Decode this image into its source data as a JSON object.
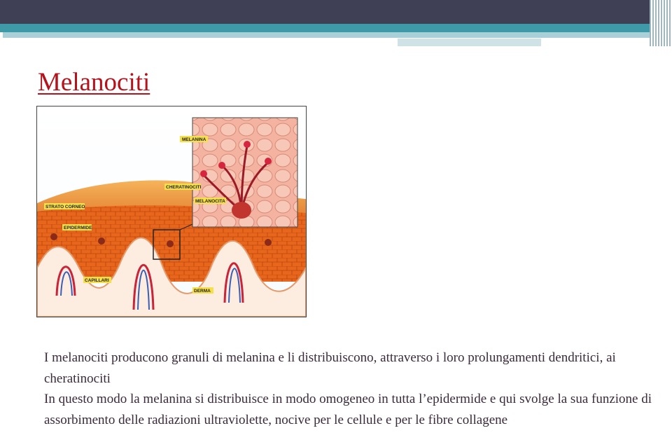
{
  "slide": {
    "title": "Melanociti",
    "figure": {
      "labels": {
        "melanina": "MELANINA",
        "cheratinociti": "CHERATINOCITI",
        "melanocita": "MELANOCITA",
        "strato_corneo": "STRATO CORNEO",
        "epidermide": "EPIDERMIDE",
        "capillari": "CAPILLARI",
        "derma": "DERMA"
      }
    },
    "paragraphs": [
      "I melanociti producono granuli di melanina e li distribuiscono, attraverso i loro prolungamenti dendritici, ai cheratinociti",
      "In questo modo la melanina si distribuisce in modo omogeneo in tutta l’epidermide e qui svolge la sua funzione di assorbimento delle radiazioni ultraviolette, nocive per le cellule e per le fibre collagene"
    ]
  },
  "colors": {
    "title": "#b5121b",
    "header_dark": "#3f3f55",
    "header_teal": "#3e9aa7",
    "skin_orange": "#e8661c",
    "label_yellow": "#f5e04a"
  }
}
